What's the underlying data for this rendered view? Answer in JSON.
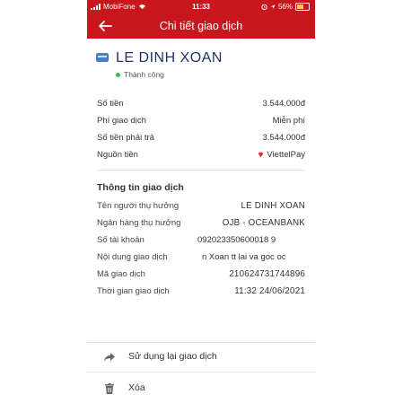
{
  "status_bar": {
    "carrier": "MobiFone",
    "time": "11:33",
    "battery": "56%"
  },
  "nav": {
    "title": "Chi tiết giao dịch"
  },
  "recipient": {
    "name": "LE DINH XOAN",
    "status": "Thành công"
  },
  "summary": [
    {
      "label": "Số tiền",
      "value": "3.544.000đ"
    },
    {
      "label": "Phí giao dịch",
      "value": "Miễn phí"
    },
    {
      "label": "Số tiền phải trả",
      "value": "3.544.000đ"
    },
    {
      "label": "Nguồn tiền",
      "value": "ViettelPay"
    }
  ],
  "details": {
    "title": "Thông tin giao dịch",
    "rows": [
      {
        "label": "Tên người thụ hưởng",
        "value": "LE DINH XOAN"
      },
      {
        "label": "Ngân hàng thụ hưởng",
        "value": "OJB - OCEANBANK"
      },
      {
        "label": "Số tài khoản",
        "value": "092023350600018  9"
      },
      {
        "label": "Nội dung giao dịch",
        "value": "n Xoan tt lai va goc oc"
      },
      {
        "label": "Mã giao dịch",
        "value": "210624731744896"
      },
      {
        "label": "Thời gian giao dịch",
        "value": "11:32 24/06/2021"
      }
    ]
  },
  "actions": {
    "reuse": "Sử dụng lại giao dịch",
    "delete": "Xóa"
  },
  "colors": {
    "brand": "#c8161d",
    "success": "#3bbb56",
    "name": "#223366"
  }
}
